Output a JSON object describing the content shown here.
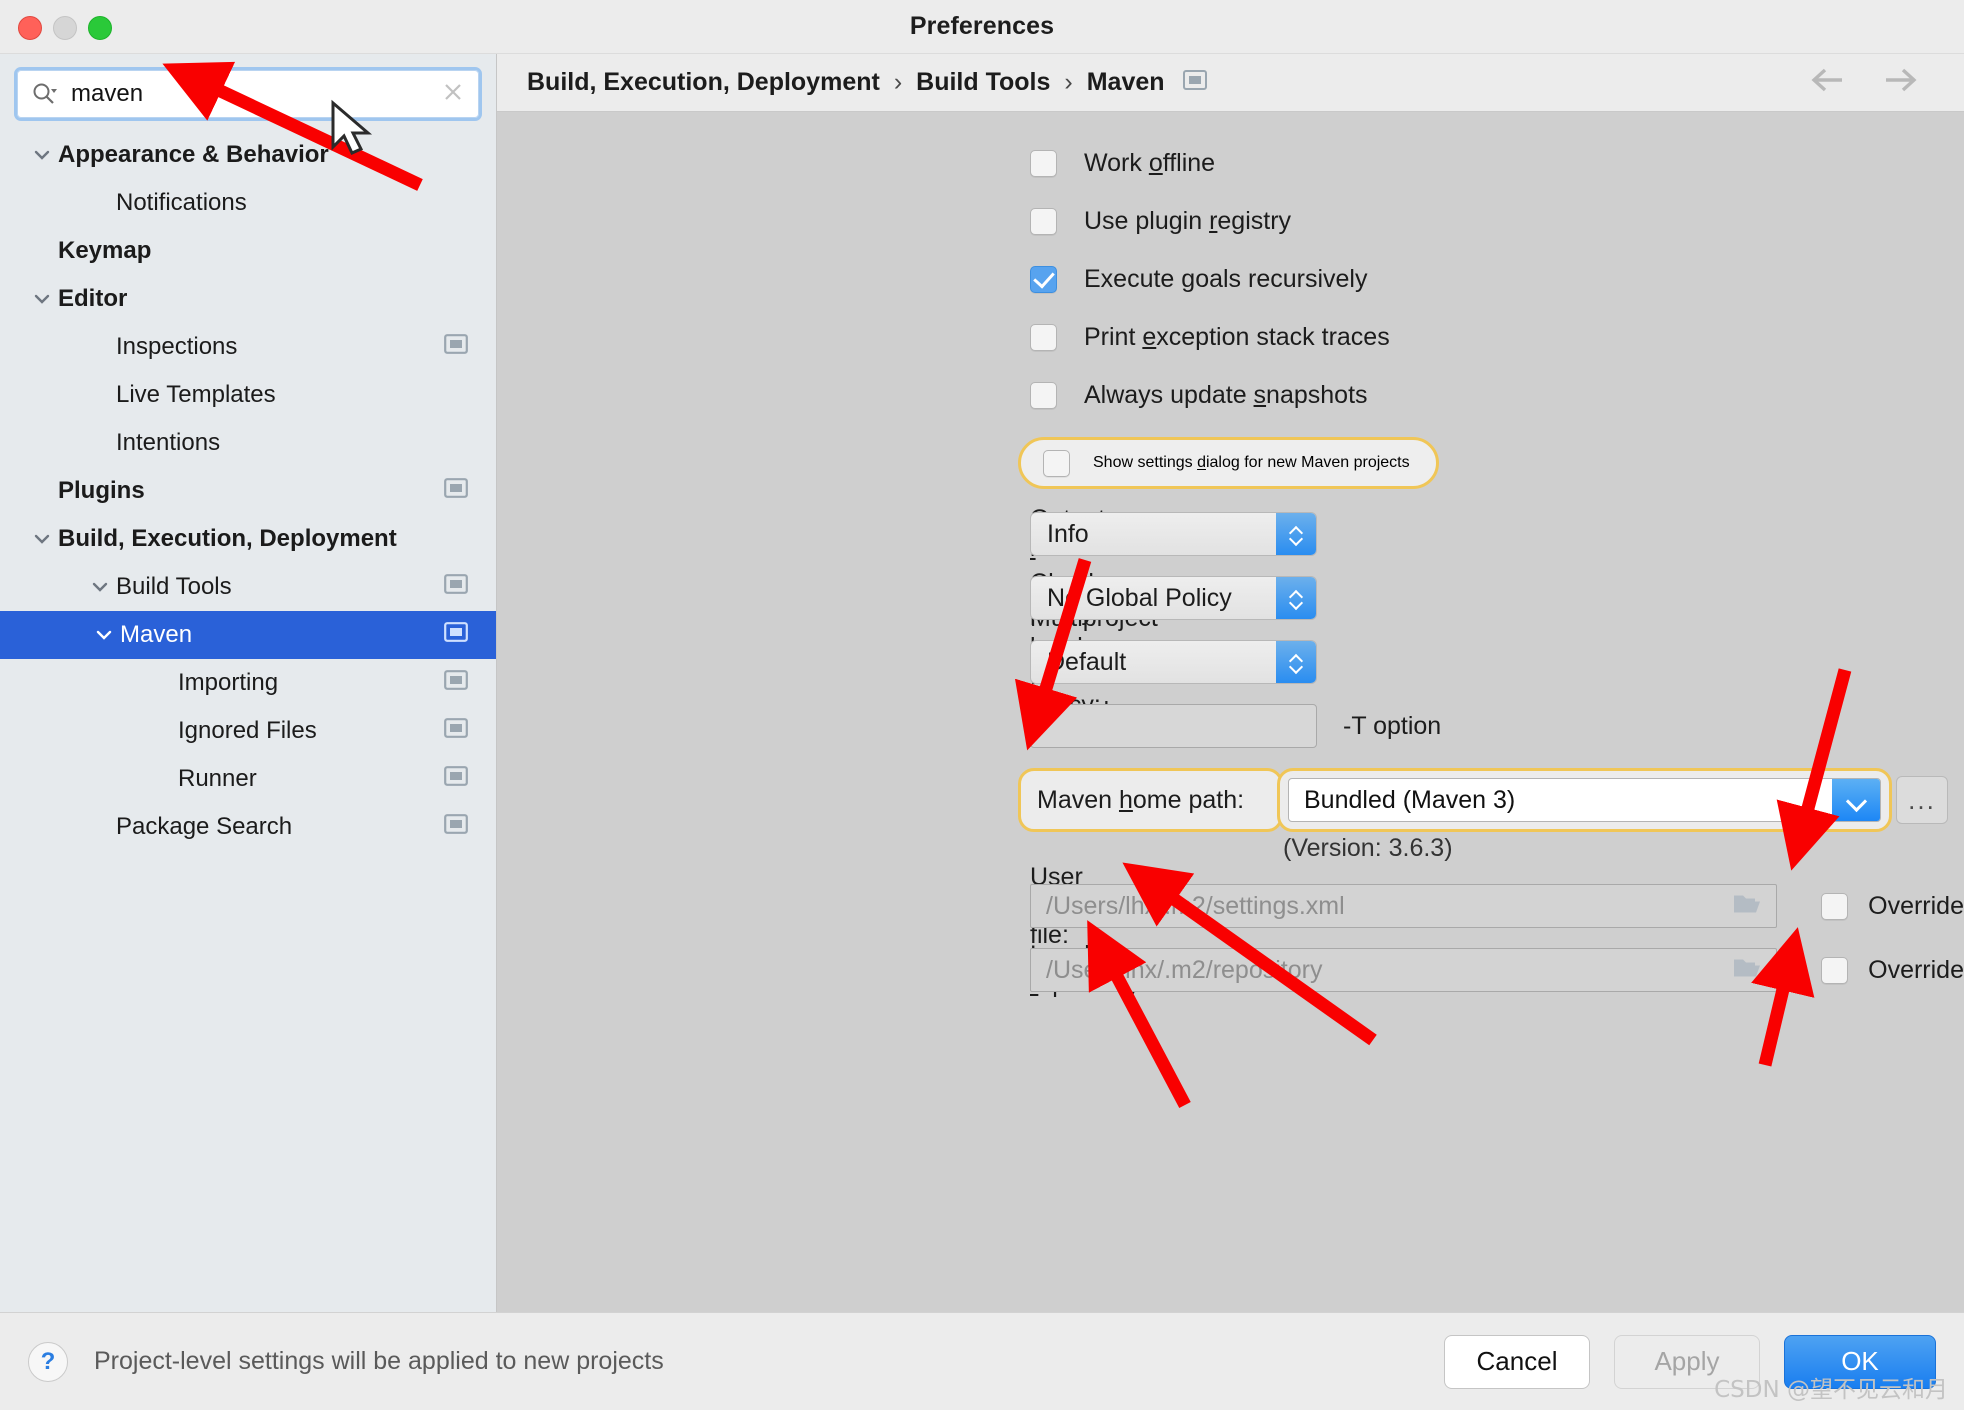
{
  "window": {
    "title": "Preferences",
    "traffic_lights": [
      "close",
      "minimize",
      "zoom"
    ]
  },
  "search": {
    "value": "maven",
    "placeholder": "",
    "icon": "search-icon",
    "clear_icon": "close-icon"
  },
  "sidebar": {
    "items": [
      {
        "label": "Appearance & Behavior",
        "level": 0,
        "bold": true,
        "twisty": "chevron-down",
        "selected": false,
        "settings_icon": false
      },
      {
        "label": "Notifications",
        "level": 1,
        "bold": false,
        "twisty": "",
        "selected": false,
        "settings_icon": false
      },
      {
        "label": "Keymap",
        "level": 0,
        "bold": true,
        "twisty": "",
        "selected": false,
        "settings_icon": false
      },
      {
        "label": "Editor",
        "level": 0,
        "bold": true,
        "twisty": "chevron-down",
        "selected": false,
        "settings_icon": false
      },
      {
        "label": "Inspections",
        "level": 1,
        "bold": false,
        "twisty": "",
        "selected": false,
        "settings_icon": true
      },
      {
        "label": "Live Templates",
        "level": 1,
        "bold": false,
        "twisty": "",
        "selected": false,
        "settings_icon": false
      },
      {
        "label": "Intentions",
        "level": 1,
        "bold": false,
        "twisty": "",
        "selected": false,
        "settings_icon": false
      },
      {
        "label": "Plugins",
        "level": 0,
        "bold": true,
        "twisty": "",
        "selected": false,
        "settings_icon": true
      },
      {
        "label": "Build, Execution, Deployment",
        "level": 0,
        "bold": true,
        "twisty": "chevron-down",
        "selected": false,
        "settings_icon": false
      },
      {
        "label": "Build Tools",
        "level": 1,
        "bold": false,
        "twisty": "chevron-down",
        "selected": false,
        "settings_icon": true
      },
      {
        "label": "Maven",
        "level": 2,
        "bold": false,
        "twisty": "chevron-down",
        "selected": true,
        "settings_icon": true
      },
      {
        "label": "Importing",
        "level": 3,
        "bold": false,
        "twisty": "",
        "selected": false,
        "settings_icon": true
      },
      {
        "label": "Ignored Files",
        "level": 3,
        "bold": false,
        "twisty": "",
        "selected": false,
        "settings_icon": true
      },
      {
        "label": "Runner",
        "level": 3,
        "bold": false,
        "twisty": "",
        "selected": false,
        "settings_icon": true
      },
      {
        "label": "Package Search",
        "level": 1,
        "bold": false,
        "twisty": "",
        "selected": false,
        "settings_icon": true
      }
    ]
  },
  "breadcrumb": {
    "parts": [
      "Build, Execution, Deployment",
      "Build Tools",
      "Maven"
    ],
    "separator": "›",
    "settings_icon": "project-settings-icon",
    "back_icon": "arrow-left-icon",
    "forward_icon": "arrow-right-icon"
  },
  "main": {
    "checkboxes": [
      {
        "label_pre": "Work ",
        "mnemonic": "o",
        "label_post": "ffline",
        "checked": false,
        "highlighted": false
      },
      {
        "label_pre": "Use plugin ",
        "mnemonic": "r",
        "label_post": "egistry",
        "checked": false,
        "highlighted": false
      },
      {
        "label_pre": "Execute ",
        "mnemonic": "g",
        "label_post": "oals recursively",
        "checked": true,
        "highlighted": false
      },
      {
        "label_pre": "Print ",
        "mnemonic": "e",
        "label_post": "xception stack traces",
        "checked": false,
        "highlighted": false
      },
      {
        "label_pre": "Always update ",
        "mnemonic": "s",
        "label_post": "napshots",
        "checked": false,
        "highlighted": false
      }
    ],
    "highlighted_checkbox": {
      "label_pre": "Show settings ",
      "mnemonic": "d",
      "label_post": "ialog for new Maven projects",
      "checked": false,
      "highlight_color": "#f0c657"
    },
    "fields": [
      {
        "label_pre": "Output ",
        "mnemonic": "l",
        "label_post": "evel:",
        "type": "popup",
        "value": "Info"
      },
      {
        "label_pre": "",
        "mnemonic": "C",
        "label_post": "hecksum policy:",
        "type": "popup",
        "value": "No Global Policy"
      },
      {
        "label_pre": "Multiproject build ",
        "mnemonic": "f",
        "label_post": "ail policy:",
        "type": "popup",
        "value": "Default"
      },
      {
        "label_pre": "Thread count",
        "mnemonic": "",
        "label_post": "",
        "type": "text",
        "value": "",
        "suffix": "-T option"
      }
    ],
    "maven_home": {
      "label_pre": "Maven ",
      "mnemonic": "h",
      "label_post": "ome path:",
      "value": "Bundled (Maven 3)",
      "dropdown_icon": "chevron-down-icon",
      "browse_label": "...",
      "version_note": "(Version: 3.6.3)",
      "highlight_color": "#f0c657"
    },
    "paths": [
      {
        "label_pre": "User ",
        "mnemonic": "s",
        "label_post": "ettings file:",
        "value": "/Users/lhx/.m2/settings.xml",
        "browse_icon": "folder-icon",
        "override_label": "Override",
        "override_checked": false
      },
      {
        "label_pre": "Local ",
        "mnemonic": "r",
        "label_post": "epository:",
        "value": "/Users/lhx/.m2/repository",
        "browse_icon": "folder-icon",
        "override_label": "Override",
        "override_checked": false
      }
    ]
  },
  "footer": {
    "help_label": "?",
    "note": "Project-level settings will be applied to new projects",
    "cancel_label": "Cancel",
    "apply_label": "Apply",
    "ok_label": "OK",
    "apply_enabled": false
  },
  "watermark": "CSDN @望不见云和月",
  "annotations": {
    "arrow_color": "#f90000",
    "count": 6,
    "description": "red arrows pointing to search field, thread count, maven home dropdown, user settings file, local repository, override checkboxes"
  }
}
